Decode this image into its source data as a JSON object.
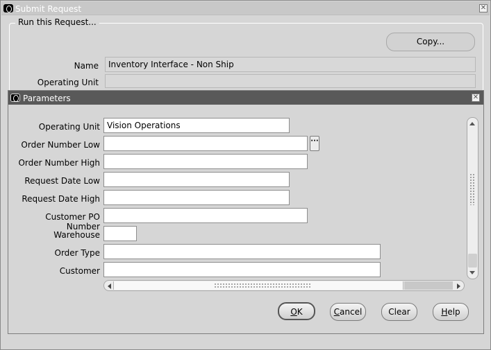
{
  "outer_window": {
    "title": "Submit Request",
    "close_glyph": "✕",
    "group_label": "Run this Request...",
    "copy_button": "Copy...",
    "fields": [
      {
        "label": "Name",
        "value": "Inventory Interface - Non Ship"
      },
      {
        "label": "Operating Unit",
        "value": ""
      }
    ]
  },
  "parameters_dialog": {
    "title": "Parameters",
    "close_glyph": "✕",
    "lov_glyph": "···",
    "fields": [
      {
        "label": "Operating Unit",
        "value": "Vision Operations"
      },
      {
        "label": "Order Number Low",
        "value": ""
      },
      {
        "label": "Order Number High",
        "value": ""
      },
      {
        "label": "Request Date Low",
        "value": ""
      },
      {
        "label": "Request Date High",
        "value": ""
      },
      {
        "label": "Customer PO Number",
        "value": ""
      },
      {
        "label": "Warehouse",
        "value": ""
      },
      {
        "label": "Order Type",
        "value": ""
      },
      {
        "label": "Customer",
        "value": ""
      }
    ],
    "buttons": {
      "ok": {
        "mnemonic": "O",
        "rest": "K"
      },
      "cancel": {
        "mnemonic": "C",
        "rest": "ancel"
      },
      "clear": {
        "mnemonic": "",
        "rest": "Clear"
      },
      "help": {
        "mnemonic": "H",
        "rest": "elp"
      }
    }
  },
  "colors": {
    "window_bg": "#d6d6d6",
    "active_title_bar": "#595959",
    "inactive_title_bar": "#c8c8c8"
  }
}
